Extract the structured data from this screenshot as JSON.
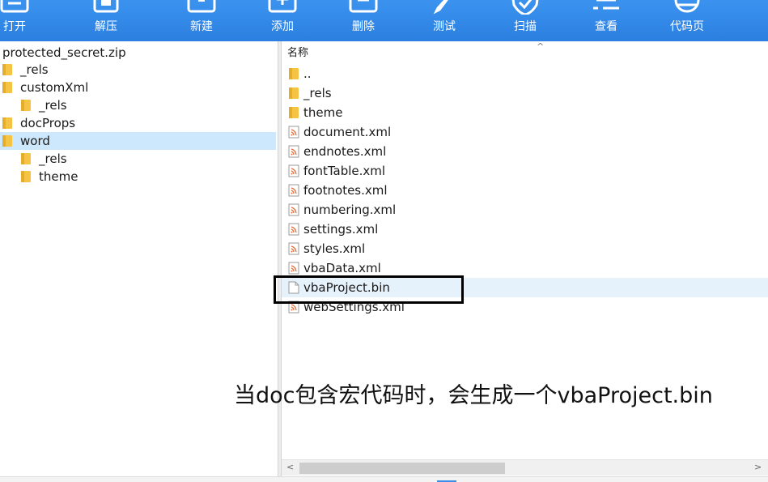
{
  "toolbar": {
    "buttons": [
      {
        "label": "打开",
        "icon": "open-icon"
      },
      {
        "label": "解压",
        "icon": "extract-icon"
      },
      {
        "label": "新建",
        "icon": "new-archive-icon"
      },
      {
        "label": "添加",
        "icon": "add-icon"
      },
      {
        "label": "删除",
        "icon": "delete-icon"
      },
      {
        "label": "测试",
        "icon": "test-icon"
      },
      {
        "label": "扫描",
        "icon": "shield-icon"
      },
      {
        "label": "查看",
        "icon": "view-icon"
      },
      {
        "label": "代码页",
        "icon": "globe-icon"
      }
    ]
  },
  "tree": {
    "root": "protected_secret.zip",
    "items": [
      {
        "label": "_rels",
        "level": 0
      },
      {
        "label": "customXml",
        "level": 0
      },
      {
        "label": "_rels",
        "level": 1
      },
      {
        "label": "docProps",
        "level": 0
      },
      {
        "label": "word",
        "level": 0,
        "selected": true
      },
      {
        "label": "_rels",
        "level": 1
      },
      {
        "label": "theme",
        "level": 1
      }
    ]
  },
  "file_list": {
    "column_name": "名称",
    "sort_arrow": "^",
    "files": [
      {
        "name": "..",
        "type": "folder"
      },
      {
        "name": "_rels",
        "type": "folder"
      },
      {
        "name": "theme",
        "type": "folder"
      },
      {
        "name": "document.xml",
        "type": "xml"
      },
      {
        "name": "endnotes.xml",
        "type": "xml"
      },
      {
        "name": "fontTable.xml",
        "type": "xml"
      },
      {
        "name": "footnotes.xml",
        "type": "xml"
      },
      {
        "name": "numbering.xml",
        "type": "xml"
      },
      {
        "name": "settings.xml",
        "type": "xml"
      },
      {
        "name": "styles.xml",
        "type": "xml"
      },
      {
        "name": "vbaData.xml",
        "type": "xml"
      },
      {
        "name": "vbaProject.bin",
        "type": "bin",
        "highlighted": true
      },
      {
        "name": "webSettings.xml",
        "type": "xml"
      }
    ]
  },
  "scroll": {
    "left_arrow": "<",
    "right_arrow": ">"
  },
  "annotation": "当doc包含宏代码时，会生成一个vbaProject.bin",
  "colors": {
    "toolbar": "#2b7fe0",
    "selected_row": "#cde8fc",
    "folder": "#f6c445",
    "xml_icon": "#e0703a"
  }
}
